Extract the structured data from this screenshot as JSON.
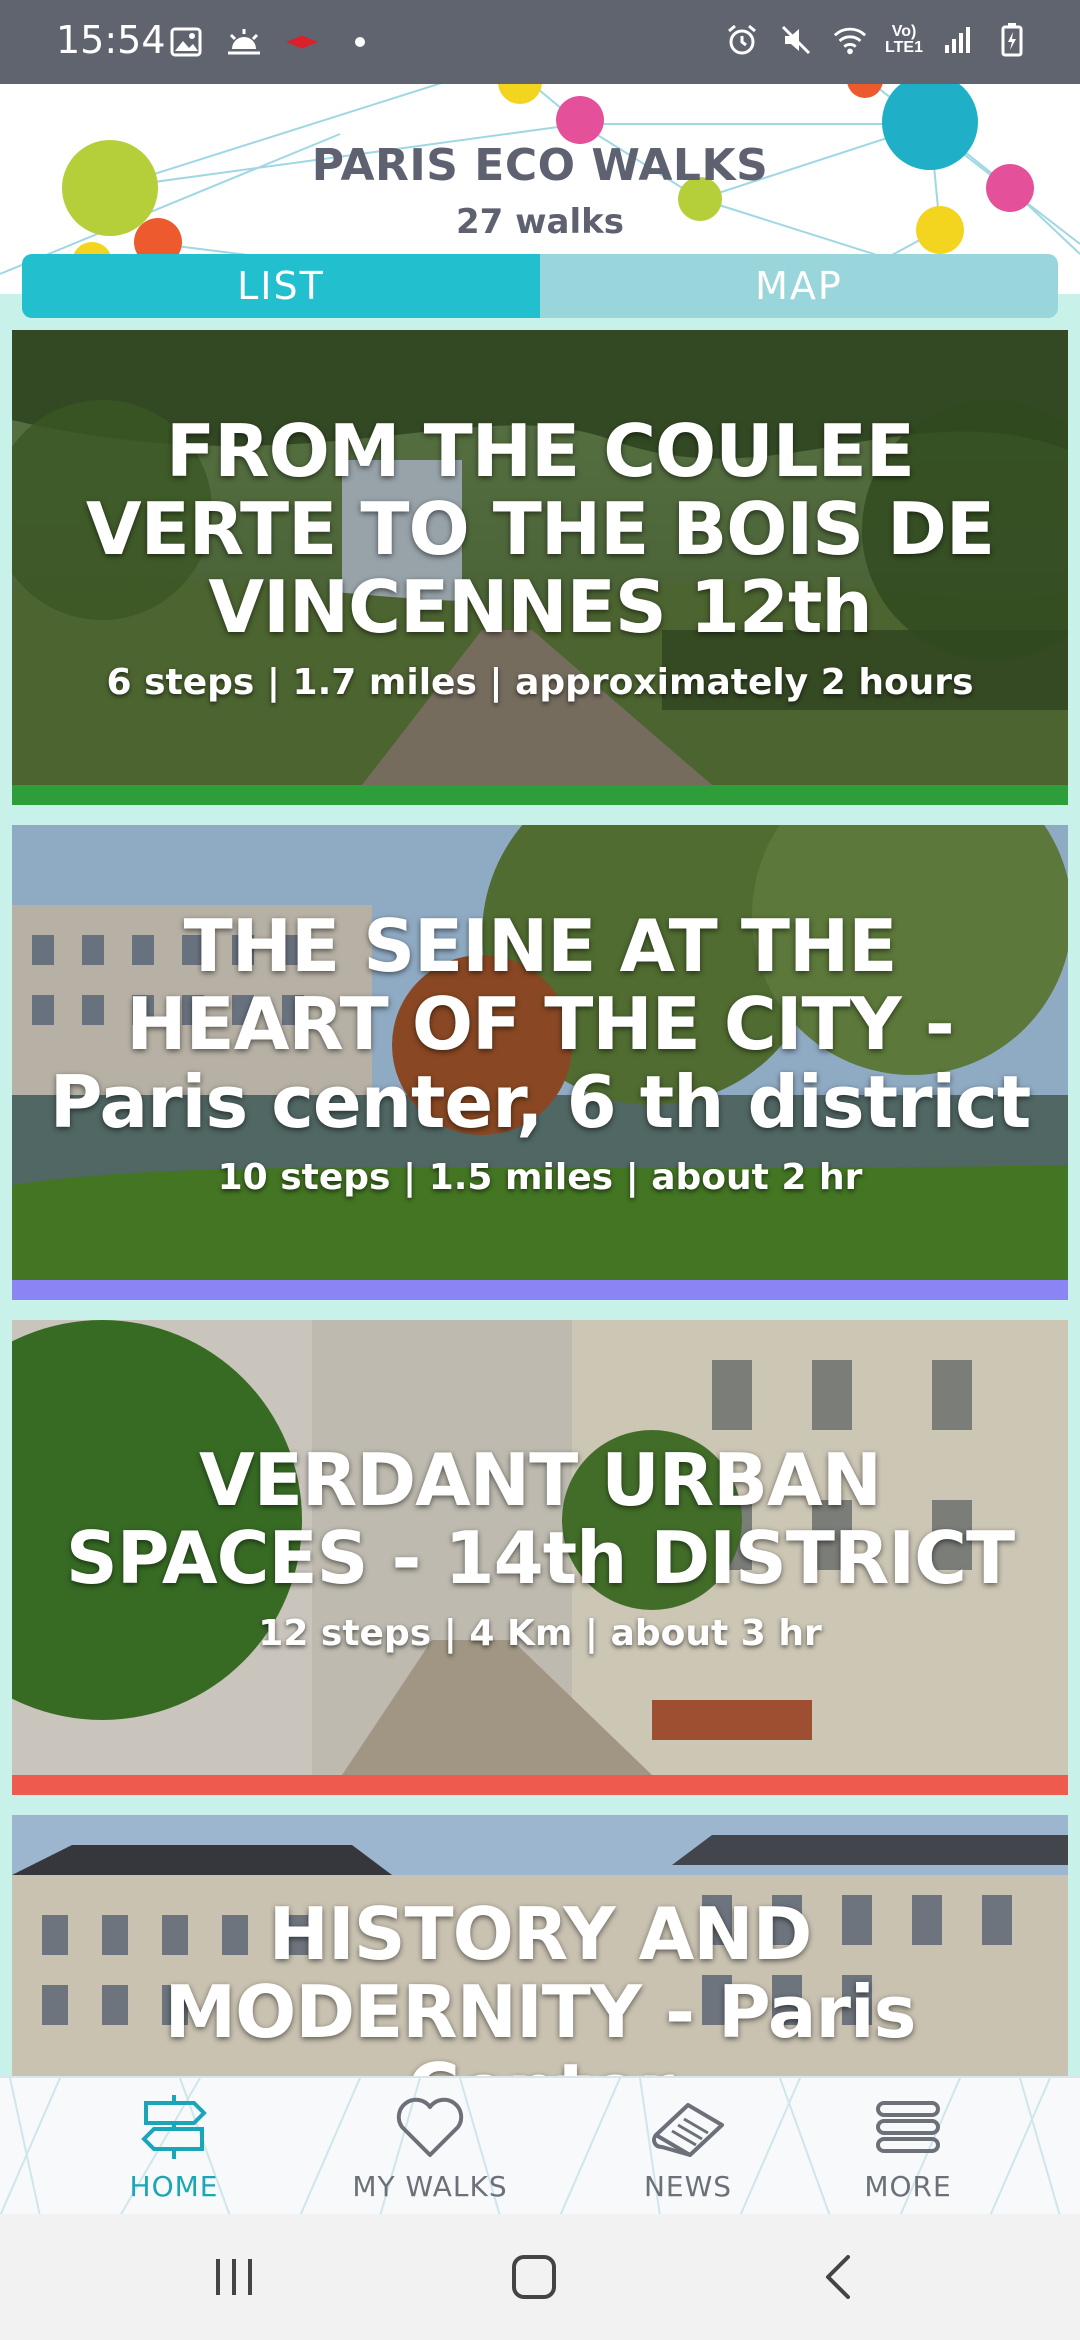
{
  "status_bar": {
    "time": "15:54",
    "volte_label": "Vo) LTE1"
  },
  "header": {
    "title": "PARIS ECO WALKS",
    "subtitle": "27 walks"
  },
  "view_toggle": {
    "list_label": "LIST",
    "map_label": "MAP",
    "selected": "LIST"
  },
  "walks": [
    {
      "title": "FROM THE COULEE VERTE TO THE BOIS DE VINCENNES 12th",
      "meta": "6 steps | 1.7 miles | approximately 2 hours",
      "accent": "#2e9e3a"
    },
    {
      "title": "THE SEINE AT THE HEART OF THE CITY - Paris center, 6 th district",
      "meta": "10 steps | 1.5 miles | about 2 hr",
      "accent": "#8a84f4"
    },
    {
      "title": "VERDANT URBAN SPACES - 14th DISTRICT",
      "meta": "12 steps | 4 Km | about 3 hr",
      "accent": "#ee5a4c"
    },
    {
      "title": "HISTORY AND MODERNITY - Paris Center",
      "meta": "",
      "accent": "#c8f1ea"
    }
  ],
  "bottom_nav": {
    "items": [
      {
        "label": "HOME",
        "icon": "signpost-icon",
        "active": true
      },
      {
        "label": "MY WALKS",
        "icon": "heart-icon",
        "active": false
      },
      {
        "label": "NEWS",
        "icon": "newspaper-icon",
        "active": false
      },
      {
        "label": "MORE",
        "icon": "menu-stack-icon",
        "active": false
      }
    ]
  },
  "colors": {
    "accent": "#22bfcf",
    "accent_light": "#99d6db",
    "background": "#c8f1ea",
    "header_text": "#5d6170",
    "nav_active": "#1aa6b8",
    "nav_inactive": "#6c7078"
  }
}
